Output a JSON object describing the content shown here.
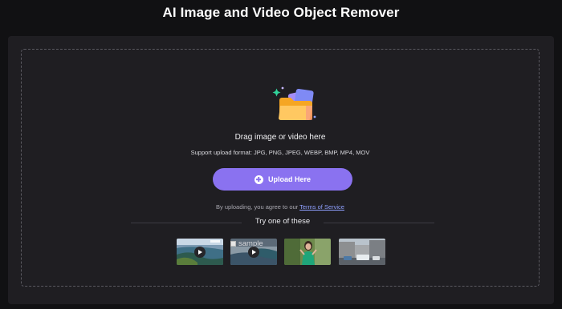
{
  "header": {
    "title": "AI Image and Video Object Remover"
  },
  "upload": {
    "drag_text": "Drag image or video here",
    "formats_text": "Support upload format: JPG, PNG, JPEG, WEBP, BMP, MP4, MOV",
    "button_label": "Upload Here",
    "agree_prefix": "By uploading, you agree to our ",
    "terms_link": "Terms of Service",
    "icon": "folder-icon"
  },
  "samples": {
    "heading": "Try one of these",
    "items": [
      {
        "kind": "video",
        "name": "coastal-aerial",
        "badge": "sample-badge"
      },
      {
        "kind": "video",
        "name": "broken-sample",
        "alt": "sample"
      },
      {
        "kind": "image",
        "name": "woman-in-green"
      },
      {
        "kind": "image",
        "name": "city-street"
      }
    ]
  },
  "colors": {
    "background": "#111113",
    "panel": "#1f1e22",
    "accent": "#8a72f0",
    "link": "#8fa0ff"
  }
}
